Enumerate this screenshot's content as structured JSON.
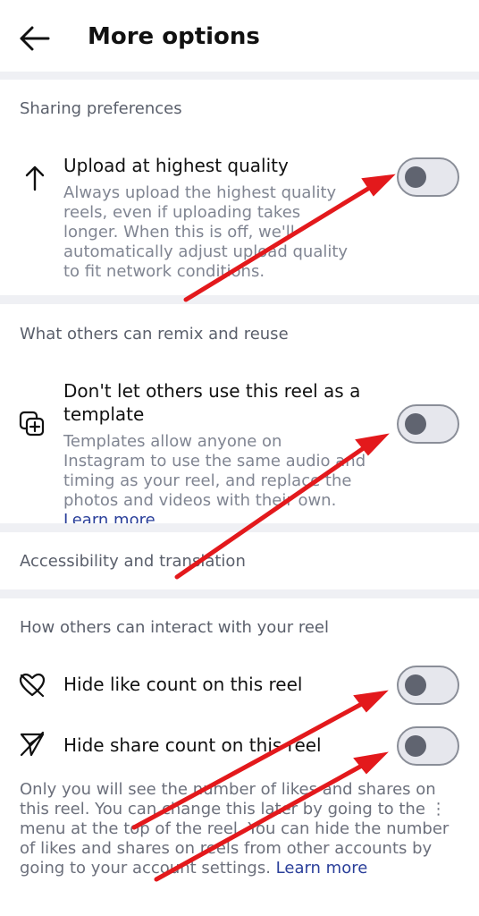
{
  "header": {
    "title": "More options",
    "back_icon": "arrow-left-icon"
  },
  "sections": {
    "sharing": {
      "title": "Sharing preferences",
      "upload": {
        "label": "Upload at highest quality",
        "description": "Always upload the highest quality reels, even if uploading takes longer. When this is off, we'll automatically adjust upload quality to fit network conditions.",
        "enabled": false,
        "icon": "arrow-up-icon"
      }
    },
    "remix": {
      "title": "What others can remix and reuse",
      "template": {
        "label": "Don't let others use this reel as a template",
        "description": "Templates allow anyone on Instagram to use the same audio and timing as your reel, and replace the photos and videos with their own.",
        "link": "Learn more",
        "enabled": false,
        "icon": "template-add-icon"
      }
    },
    "accessibility": {
      "title": "Accessibility and translation"
    },
    "interact": {
      "title": "How others can interact with your reel",
      "hide_likes": {
        "label": "Hide like count on this reel",
        "enabled": false,
        "icon": "heart-off-icon"
      },
      "hide_shares": {
        "label": "Hide share count on this reel",
        "enabled": false,
        "icon": "share-off-icon"
      },
      "footer_part1": "Only you will see the number of likes and shares on this reel. You can change this later by going to the ⋮ menu at the top of the reel. You can hide the number of likes and shares on reels from other accounts by going to your account settings.",
      "footer_link": "Learn more"
    }
  },
  "colors": {
    "annotation_arrow": "#e3191c",
    "link": "#2a3f9a",
    "divider": "#eff0f4"
  }
}
